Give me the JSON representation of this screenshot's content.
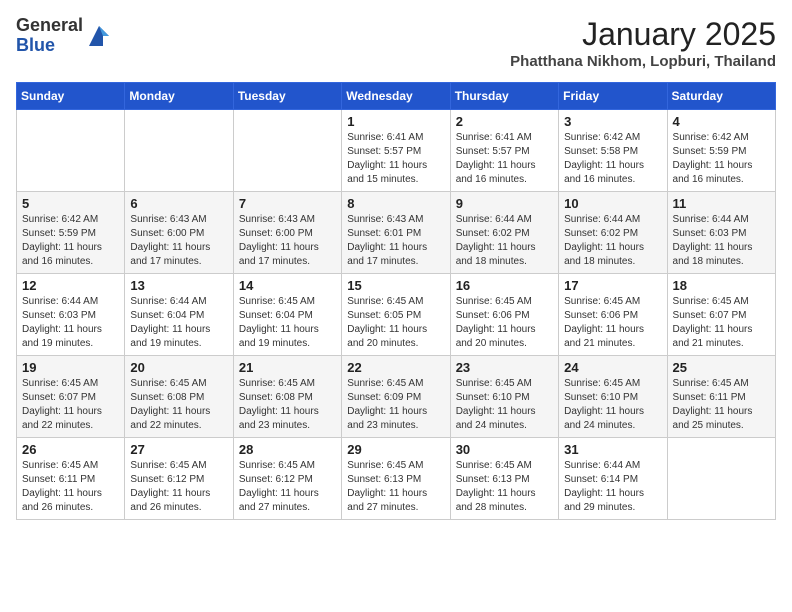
{
  "header": {
    "logo_general": "General",
    "logo_blue": "Blue",
    "title": "January 2025",
    "location": "Phatthana Nikhom, Lopburi, Thailand"
  },
  "weekdays": [
    "Sunday",
    "Monday",
    "Tuesday",
    "Wednesday",
    "Thursday",
    "Friday",
    "Saturday"
  ],
  "weeks": [
    [
      {
        "day": "",
        "info": ""
      },
      {
        "day": "",
        "info": ""
      },
      {
        "day": "",
        "info": ""
      },
      {
        "day": "1",
        "info": "Sunrise: 6:41 AM\nSunset: 5:57 PM\nDaylight: 11 hours and 15 minutes."
      },
      {
        "day": "2",
        "info": "Sunrise: 6:41 AM\nSunset: 5:57 PM\nDaylight: 11 hours and 16 minutes."
      },
      {
        "day": "3",
        "info": "Sunrise: 6:42 AM\nSunset: 5:58 PM\nDaylight: 11 hours and 16 minutes."
      },
      {
        "day": "4",
        "info": "Sunrise: 6:42 AM\nSunset: 5:59 PM\nDaylight: 11 hours and 16 minutes."
      }
    ],
    [
      {
        "day": "5",
        "info": "Sunrise: 6:42 AM\nSunset: 5:59 PM\nDaylight: 11 hours and 16 minutes."
      },
      {
        "day": "6",
        "info": "Sunrise: 6:43 AM\nSunset: 6:00 PM\nDaylight: 11 hours and 17 minutes."
      },
      {
        "day": "7",
        "info": "Sunrise: 6:43 AM\nSunset: 6:00 PM\nDaylight: 11 hours and 17 minutes."
      },
      {
        "day": "8",
        "info": "Sunrise: 6:43 AM\nSunset: 6:01 PM\nDaylight: 11 hours and 17 minutes."
      },
      {
        "day": "9",
        "info": "Sunrise: 6:44 AM\nSunset: 6:02 PM\nDaylight: 11 hours and 18 minutes."
      },
      {
        "day": "10",
        "info": "Sunrise: 6:44 AM\nSunset: 6:02 PM\nDaylight: 11 hours and 18 minutes."
      },
      {
        "day": "11",
        "info": "Sunrise: 6:44 AM\nSunset: 6:03 PM\nDaylight: 11 hours and 18 minutes."
      }
    ],
    [
      {
        "day": "12",
        "info": "Sunrise: 6:44 AM\nSunset: 6:03 PM\nDaylight: 11 hours and 19 minutes."
      },
      {
        "day": "13",
        "info": "Sunrise: 6:44 AM\nSunset: 6:04 PM\nDaylight: 11 hours and 19 minutes."
      },
      {
        "day": "14",
        "info": "Sunrise: 6:45 AM\nSunset: 6:04 PM\nDaylight: 11 hours and 19 minutes."
      },
      {
        "day": "15",
        "info": "Sunrise: 6:45 AM\nSunset: 6:05 PM\nDaylight: 11 hours and 20 minutes."
      },
      {
        "day": "16",
        "info": "Sunrise: 6:45 AM\nSunset: 6:06 PM\nDaylight: 11 hours and 20 minutes."
      },
      {
        "day": "17",
        "info": "Sunrise: 6:45 AM\nSunset: 6:06 PM\nDaylight: 11 hours and 21 minutes."
      },
      {
        "day": "18",
        "info": "Sunrise: 6:45 AM\nSunset: 6:07 PM\nDaylight: 11 hours and 21 minutes."
      }
    ],
    [
      {
        "day": "19",
        "info": "Sunrise: 6:45 AM\nSunset: 6:07 PM\nDaylight: 11 hours and 22 minutes."
      },
      {
        "day": "20",
        "info": "Sunrise: 6:45 AM\nSunset: 6:08 PM\nDaylight: 11 hours and 22 minutes."
      },
      {
        "day": "21",
        "info": "Sunrise: 6:45 AM\nSunset: 6:08 PM\nDaylight: 11 hours and 23 minutes."
      },
      {
        "day": "22",
        "info": "Sunrise: 6:45 AM\nSunset: 6:09 PM\nDaylight: 11 hours and 23 minutes."
      },
      {
        "day": "23",
        "info": "Sunrise: 6:45 AM\nSunset: 6:10 PM\nDaylight: 11 hours and 24 minutes."
      },
      {
        "day": "24",
        "info": "Sunrise: 6:45 AM\nSunset: 6:10 PM\nDaylight: 11 hours and 24 minutes."
      },
      {
        "day": "25",
        "info": "Sunrise: 6:45 AM\nSunset: 6:11 PM\nDaylight: 11 hours and 25 minutes."
      }
    ],
    [
      {
        "day": "26",
        "info": "Sunrise: 6:45 AM\nSunset: 6:11 PM\nDaylight: 11 hours and 26 minutes."
      },
      {
        "day": "27",
        "info": "Sunrise: 6:45 AM\nSunset: 6:12 PM\nDaylight: 11 hours and 26 minutes."
      },
      {
        "day": "28",
        "info": "Sunrise: 6:45 AM\nSunset: 6:12 PM\nDaylight: 11 hours and 27 minutes."
      },
      {
        "day": "29",
        "info": "Sunrise: 6:45 AM\nSunset: 6:13 PM\nDaylight: 11 hours and 27 minutes."
      },
      {
        "day": "30",
        "info": "Sunrise: 6:45 AM\nSunset: 6:13 PM\nDaylight: 11 hours and 28 minutes."
      },
      {
        "day": "31",
        "info": "Sunrise: 6:44 AM\nSunset: 6:14 PM\nDaylight: 11 hours and 29 minutes."
      },
      {
        "day": "",
        "info": ""
      }
    ]
  ]
}
